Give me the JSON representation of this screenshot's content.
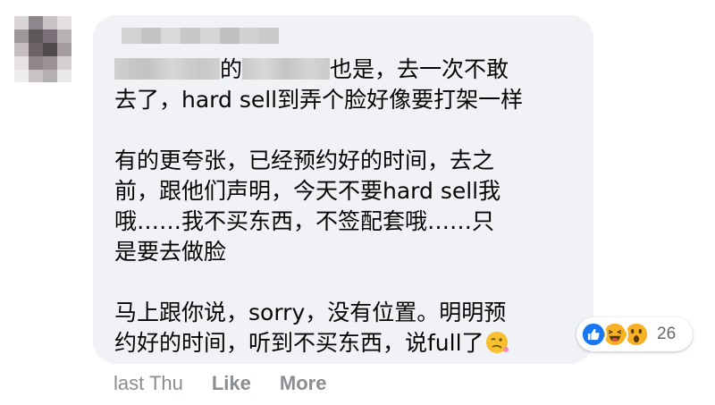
{
  "comment": {
    "author_name_visible": false,
    "body_lines": {
      "l1_mid": "的",
      "l1_end": "也是，去一次不敢",
      "l2": "去了，hard sell到弄个脸好像要打架一样",
      "l3": "有的更夸张，已经预约好的时间，去之",
      "l4": "前，跟他们声明，今天不要hard sell我",
      "l5": "哦……我不买东西，不签配套哦……只",
      "l6": "是要去做脸",
      "l7": "马上跟你说，sorry，没有位置。明明预",
      "l8": "约好的时间，听到不买东西，说full了"
    },
    "inline_emoji": "woozy-face-emoji"
  },
  "reactions": {
    "icons": [
      "like-icon",
      "haha-icon",
      "wow-icon"
    ],
    "count": "26",
    "colors": {
      "like": "#1877f2",
      "haha": "#f7b125",
      "wow": "#f7b125"
    }
  },
  "actions": {
    "timestamp": "last Thu",
    "like_label": "Like",
    "more_label": "More"
  },
  "colors": {
    "bubble_bg": "#f0f2f5",
    "text": "#050505",
    "secondary": "#8a8d91"
  }
}
